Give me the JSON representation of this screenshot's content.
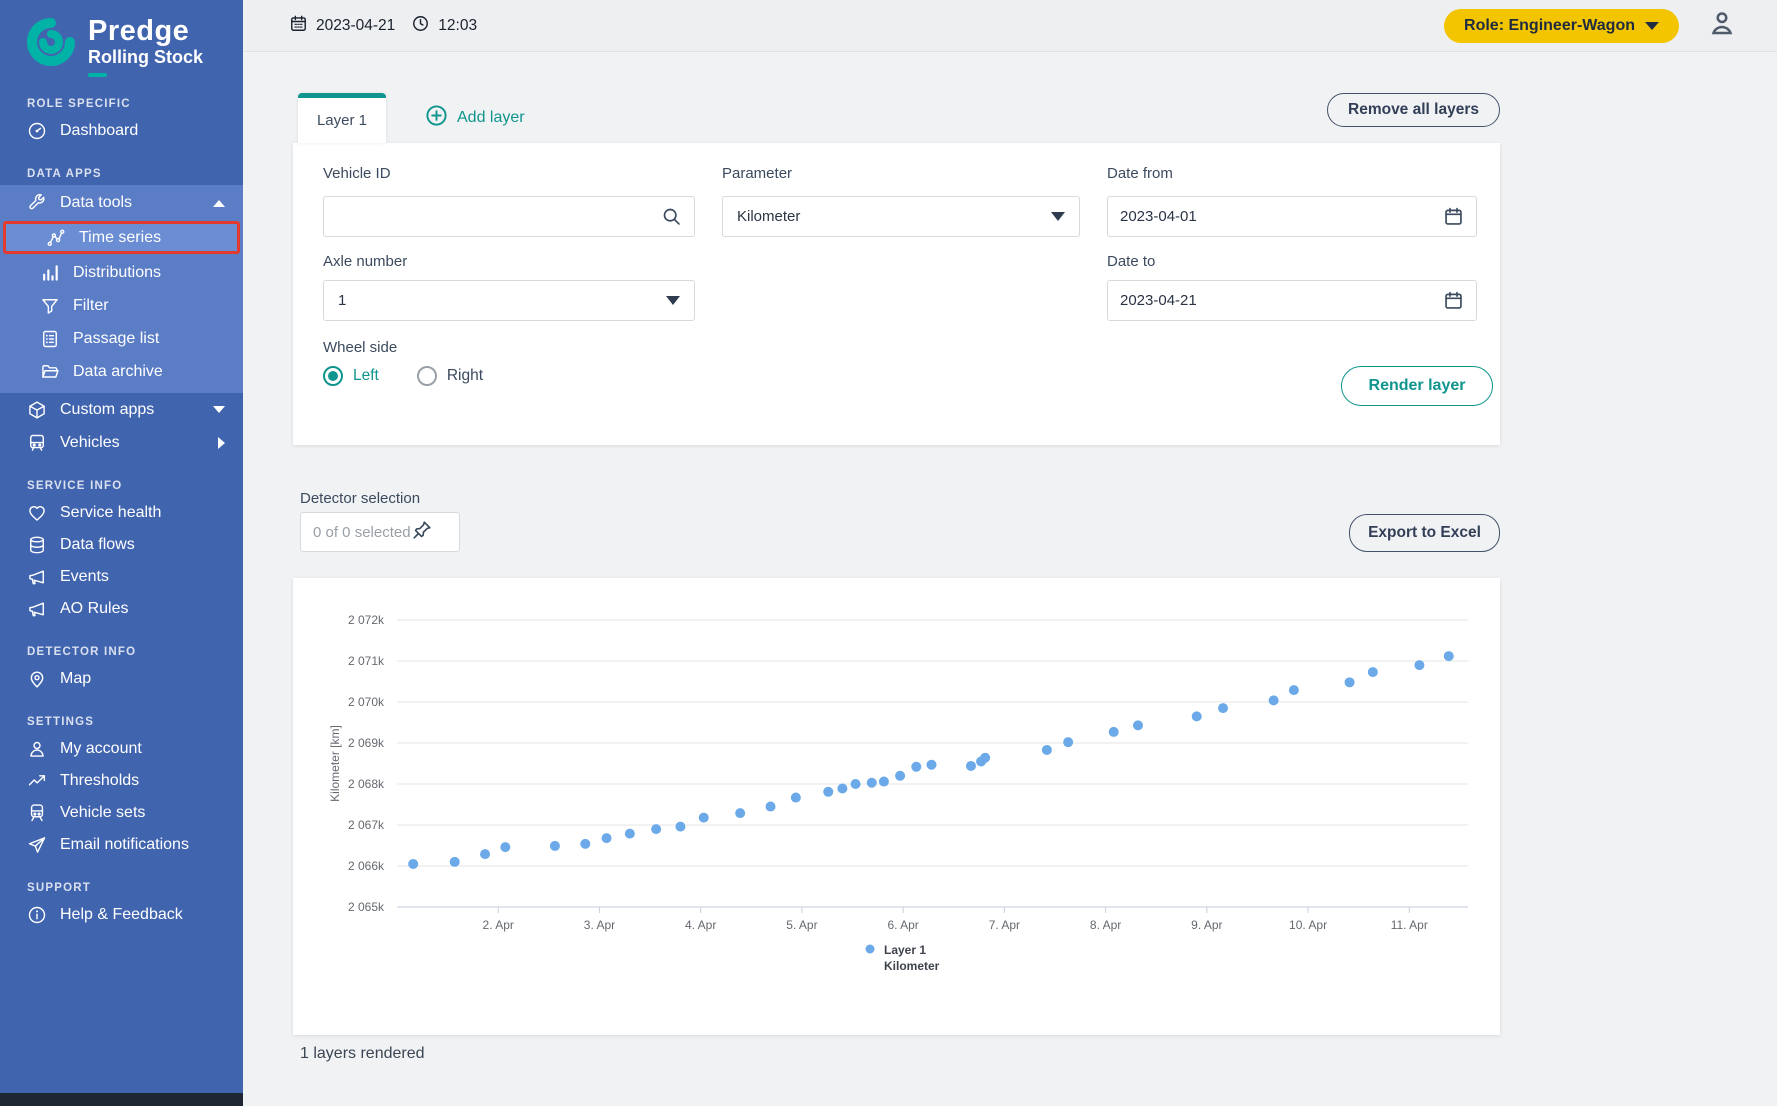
{
  "sidebar": {
    "logo_title": "Predge",
    "logo_subtitle": "Rolling Stock",
    "sections": [
      {
        "header": "ROLE SPECIFIC",
        "items": [
          {
            "label": "Dashboard"
          }
        ]
      },
      {
        "header": "DATA APPS",
        "items": [
          {
            "label": "Data tools"
          },
          {
            "label": "Time series"
          },
          {
            "label": "Distributions"
          },
          {
            "label": "Filter"
          },
          {
            "label": "Passage list"
          },
          {
            "label": "Data archive"
          },
          {
            "label": "Custom apps"
          },
          {
            "label": "Vehicles"
          }
        ]
      },
      {
        "header": "SERVICE INFO",
        "items": [
          {
            "label": "Service health"
          },
          {
            "label": "Data flows"
          },
          {
            "label": "Events"
          },
          {
            "label": "AO Rules"
          }
        ]
      },
      {
        "header": "DETECTOR INFO",
        "items": [
          {
            "label": "Map"
          }
        ]
      },
      {
        "header": "SETTINGS",
        "items": [
          {
            "label": "My account"
          },
          {
            "label": "Thresholds"
          },
          {
            "label": "Vehicle sets"
          },
          {
            "label": "Email notifications"
          }
        ]
      },
      {
        "header": "SUPPORT",
        "items": [
          {
            "label": "Help & Feedback"
          }
        ]
      }
    ]
  },
  "topbar": {
    "date": "2023-04-21",
    "time": "12:03",
    "role_label": "Role: Engineer-Wagon"
  },
  "panel": {
    "tab_label": "Layer 1",
    "add_layer_label": "Add layer",
    "remove_all_label": "Remove all layers",
    "vehicle_id_label": "Vehicle ID",
    "vehicle_id_value": "",
    "parameter_label": "Parameter",
    "parameter_value": "Kilometer",
    "date_from_label": "Date from",
    "date_from_value": "2023-04-01",
    "axle_label": "Axle number",
    "axle_value": "1",
    "date_to_label": "Date to",
    "date_to_value": "2023-04-21",
    "wheel_side_label": "Wheel side",
    "wheel_left": "Left",
    "wheel_right": "Right",
    "render_label": "Render layer"
  },
  "detector": {
    "label": "Detector selection",
    "selection_text": "0 of 0 selected",
    "export_label": "Export to Excel"
  },
  "footer_status": "1 layers rendered",
  "colors": {
    "sidebar_blue": "#4164ae",
    "submenu_blue": "#5b7dc6",
    "selected_blue": "#6a8dd3",
    "annotation_red": "#e23b2e",
    "accent_teal": "#0f958e",
    "logo_teal": "#00b3a6",
    "role_yellow": "#f3c500",
    "point_blue": "#6ba9e9"
  },
  "chart_data": {
    "type": "scatter",
    "title": "",
    "xlabel": "",
    "ylabel": "Kilometer [km]",
    "xlim": [
      1.0,
      11.58
    ],
    "ylim": [
      2065,
      2072
    ],
    "grid": true,
    "legend_position": "bottom-center",
    "legend": {
      "line1": "Layer 1",
      "line2": "Kilometer"
    },
    "y_ticks": [
      {
        "v": 2065,
        "label": "2 065k"
      },
      {
        "v": 2066,
        "label": "2 066k"
      },
      {
        "v": 2067,
        "label": "2 067k"
      },
      {
        "v": 2068,
        "label": "2 068k"
      },
      {
        "v": 2069,
        "label": "2 069k"
      },
      {
        "v": 2070,
        "label": "2 070k"
      },
      {
        "v": 2071,
        "label": "2 071k"
      },
      {
        "v": 2072,
        "label": "2 072k"
      }
    ],
    "x_ticks": [
      {
        "v": 2,
        "label": "2. Apr"
      },
      {
        "v": 3,
        "label": "3. Apr"
      },
      {
        "v": 4,
        "label": "4. Apr"
      },
      {
        "v": 5,
        "label": "5. Apr"
      },
      {
        "v": 6,
        "label": "6. Apr"
      },
      {
        "v": 7,
        "label": "7. Apr"
      },
      {
        "v": 8,
        "label": "8. Apr"
      },
      {
        "v": 9,
        "label": "9. Apr"
      },
      {
        "v": 10,
        "label": "10. Apr"
      },
      {
        "v": 11,
        "label": "11. Apr"
      }
    ],
    "series": [
      {
        "name": "Layer 1 Kilometer",
        "color": "#6ba9e9",
        "points": [
          [
            1.16,
            2066.05
          ],
          [
            1.57,
            2066.1
          ],
          [
            1.87,
            2066.29
          ],
          [
            2.07,
            2066.46
          ],
          [
            2.56,
            2066.49
          ],
          [
            2.86,
            2066.54
          ],
          [
            3.07,
            2066.68
          ],
          [
            3.3,
            2066.79
          ],
          [
            3.56,
            2066.9
          ],
          [
            3.8,
            2066.96
          ],
          [
            4.03,
            2067.18
          ],
          [
            4.39,
            2067.29
          ],
          [
            4.69,
            2067.45
          ],
          [
            4.94,
            2067.67
          ],
          [
            5.26,
            2067.81
          ],
          [
            5.4,
            2067.89
          ],
          [
            5.53,
            2068.0
          ],
          [
            5.69,
            2068.03
          ],
          [
            5.81,
            2068.06
          ],
          [
            5.97,
            2068.2
          ],
          [
            6.13,
            2068.42
          ],
          [
            6.28,
            2068.47
          ],
          [
            6.67,
            2068.44
          ],
          [
            6.77,
            2068.55
          ],
          [
            6.81,
            2068.64
          ],
          [
            7.42,
            2068.83
          ],
          [
            7.63,
            2069.02
          ],
          [
            8.08,
            2069.27
          ],
          [
            8.32,
            2069.43
          ],
          [
            8.9,
            2069.65
          ],
          [
            9.16,
            2069.85
          ],
          [
            9.66,
            2070.04
          ],
          [
            9.86,
            2070.29
          ],
          [
            10.41,
            2070.48
          ],
          [
            10.64,
            2070.73
          ],
          [
            11.1,
            2070.9
          ],
          [
            11.39,
            2071.12
          ]
        ]
      }
    ]
  }
}
